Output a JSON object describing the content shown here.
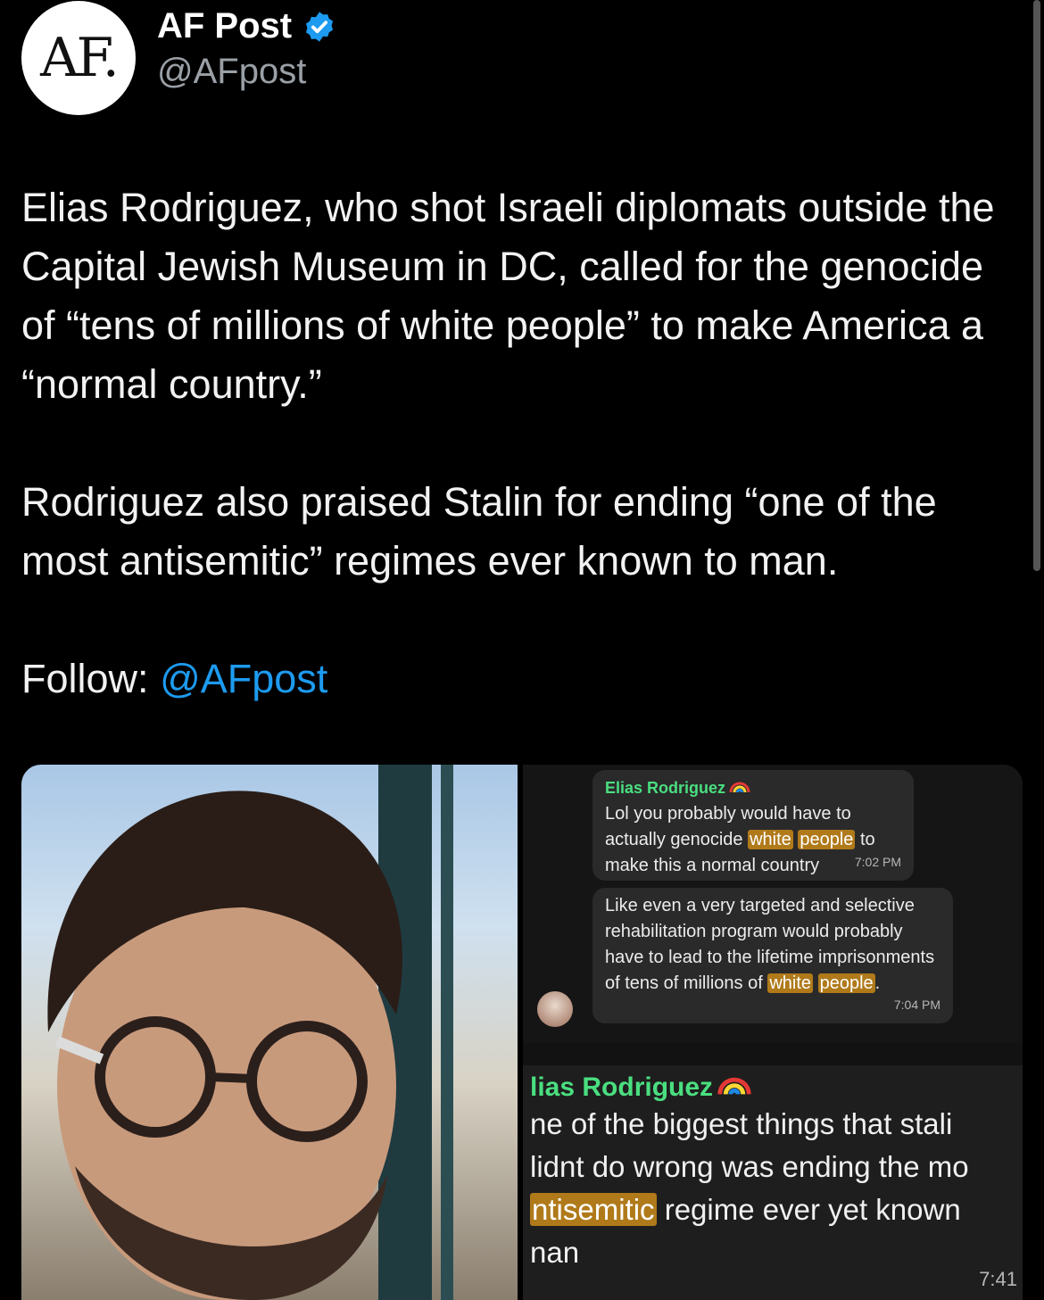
{
  "account": {
    "avatar_text": "AF.",
    "display_name": "AF Post",
    "handle": "@AFpost"
  },
  "tweet": {
    "paragraph_1": "Elias Rodriguez, who shot Israeli diplomats outside the Capital Jewish Museum in DC, called for the genocide of “tens of millions of white people” to make America a “normal country.”",
    "paragraph_2": "Rodriguez also praised Stalin for ending “one of the most antisemitic” regimes  ever known to man.",
    "follow_label": "Follow:",
    "follow_handle": "@AFpost"
  },
  "chat": {
    "sender": "Elias Rodriguez",
    "msg1": {
      "pre": "Lol you probably would have to actually genocide ",
      "hl1": "white",
      "hl2": "people",
      "post": " to make this a normal country",
      "time": "7:02 PM"
    },
    "msg2": {
      "pre": "Like even a very targeted and selective rehabilitation program would probably have to lead to the lifetime imprisonments of tens of millions of ",
      "hl1": "white",
      "hl2": "people",
      "post": ".",
      "time": "7:04 PM"
    },
    "big": {
      "sender": "lias Rodriguez",
      "line1": "ne of the biggest things that stali",
      "line2": "lidnt do wrong was ending the mo",
      "line3_hl": "ntisemitic",
      "line3_post": " regime ever yet known",
      "line4": "nan",
      "time": "7:41"
    }
  },
  "colors": {
    "accent": "#1d9bf0",
    "sender_green": "#4ade80",
    "highlight": "#b07a1a"
  }
}
